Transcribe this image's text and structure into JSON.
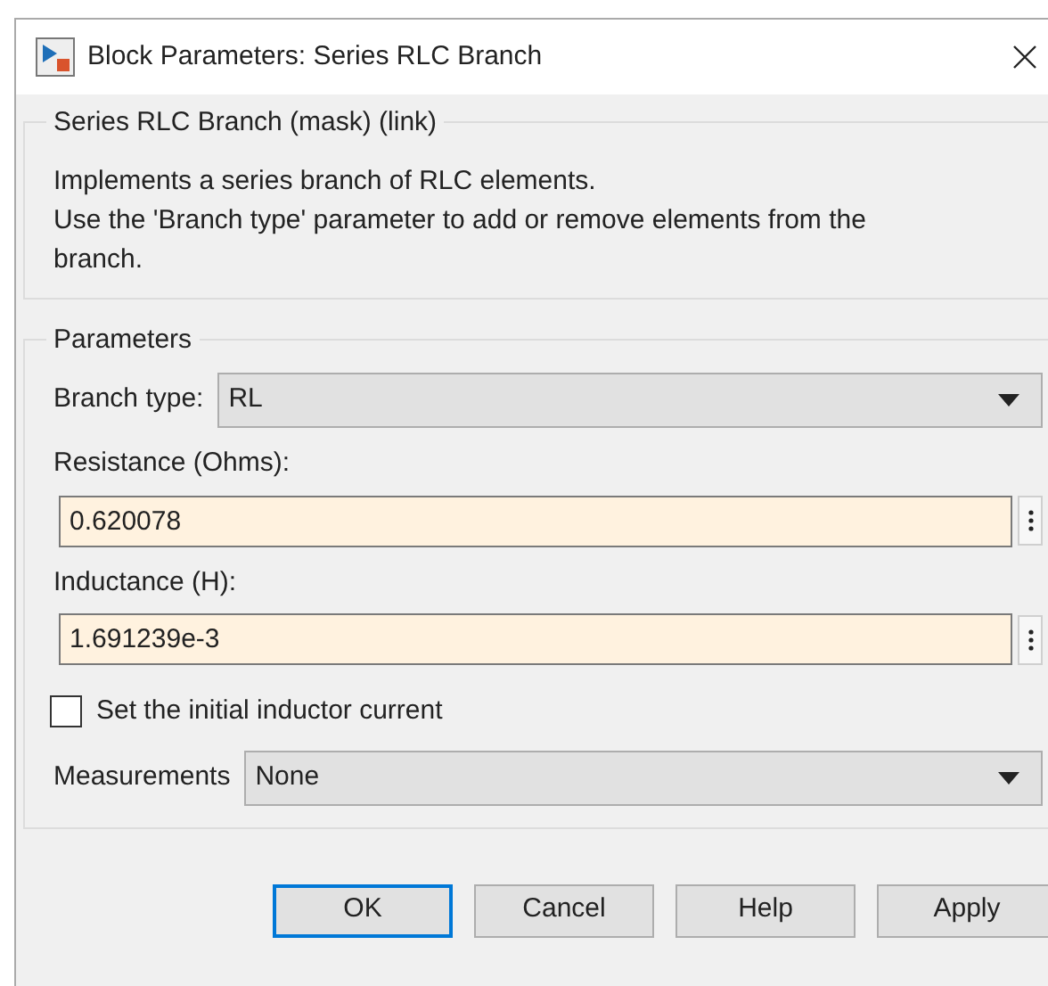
{
  "window": {
    "title": "Block Parameters: Series RLC Branch"
  },
  "description_group": {
    "title": "Series RLC Branch (mask) (link)",
    "lines": [
      "Implements a series branch of RLC elements.",
      "Use the 'Branch type' parameter to add or remove elements from the",
      "branch."
    ]
  },
  "parameters_group": {
    "title": "Parameters",
    "items": [
      {
        "kind": "dropdown",
        "label": "Branch type:",
        "value": "RL"
      },
      {
        "kind": "field",
        "label": "Resistance (Ohms):",
        "value": "0.620078"
      },
      {
        "kind": "field",
        "label": "Inductance (H):",
        "value": "1.691239e-3"
      },
      {
        "kind": "checkbox",
        "label": "Set the initial inductor current",
        "checked": false
      },
      {
        "kind": "dropdown",
        "label": "Measurements",
        "value": "None"
      }
    ]
  },
  "buttons": [
    {
      "label": "OK",
      "focused": true
    },
    {
      "label": "Cancel",
      "focused": false
    },
    {
      "label": "Help",
      "focused": false
    },
    {
      "label": "Apply",
      "focused": false
    }
  ]
}
